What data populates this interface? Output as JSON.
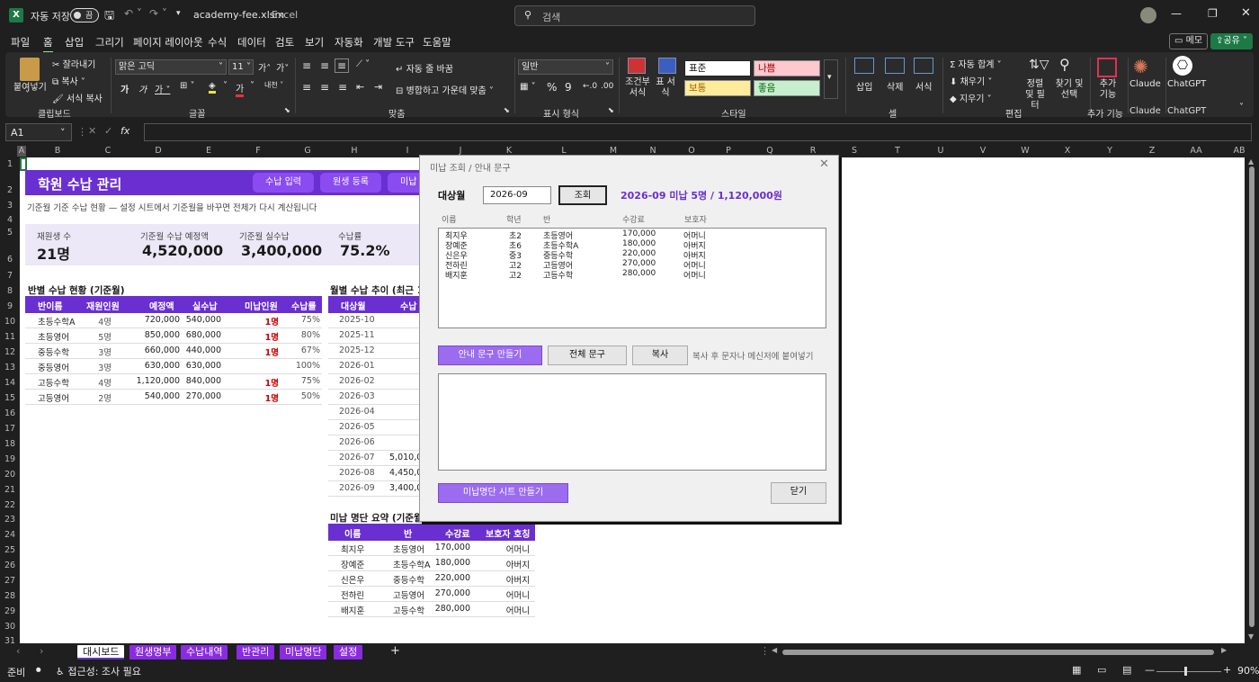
{
  "titlebar": {
    "autosave_label": "자동 저장",
    "toggle_state": "끔",
    "filename": "academy-fee.xlsm",
    "app": "Excel",
    "search_placeholder": "검색"
  },
  "menu": {
    "items": [
      "파일",
      "홈",
      "삽입",
      "그리기",
      "페이지 레이아웃",
      "수식",
      "데이터",
      "검토",
      "보기",
      "자동화",
      "개발 도구",
      "도움말"
    ],
    "active": "홈",
    "memo": "메모",
    "share": "공유"
  },
  "ribbon": {
    "clipboard": {
      "paste": "붙여넣기",
      "cut": "잘라내기",
      "copy": "복사",
      "format_painter": "서식 복사",
      "label": "클립보드"
    },
    "font": {
      "name": "맑은 고딕",
      "size": "11",
      "label": "글꼴"
    },
    "align": {
      "wrap": "자동 줄 바꿈",
      "merge": "병합하고 가운데 맞춤",
      "label": "맞춤"
    },
    "number": {
      "format": "일반",
      "label": "표시 형식"
    },
    "styles": {
      "cond": "조건부 서식",
      "table": "표 서식",
      "s1": "표준",
      "s2": "나쁨",
      "s3": "보통",
      "s4": "좋음",
      "label": "스타일"
    },
    "cells": {
      "insert": "삽입",
      "delete": "삭제",
      "format": "서식",
      "label": "셀"
    },
    "edit": {
      "autosum": "자동 합계",
      "fill": "채우기",
      "clear": "지우기",
      "sort": "정렬 및 필터",
      "find": "찾기 및 선택",
      "label": "편집"
    },
    "addins": {
      "label": "추가 기능",
      "btn": "추가 기능"
    },
    "claude": {
      "label": "Claude",
      "btn": "Claude"
    },
    "chatgpt": {
      "label": "ChatGPT",
      "btn": "ChatGPT"
    }
  },
  "formula": {
    "cell": "A1",
    "fx": "fx"
  },
  "columns": [
    "A",
    "B",
    "C",
    "D",
    "E",
    "F",
    "G",
    "H",
    "I",
    "J",
    "K",
    "L",
    "M",
    "N",
    "O",
    "P",
    "Q",
    "R",
    "S",
    "T",
    "U",
    "V",
    "W",
    "X",
    "Y",
    "Z",
    "AA",
    "AB"
  ],
  "rows": [
    "1",
    "2",
    "3",
    "4",
    "5",
    "6",
    "7",
    "8",
    "9",
    "10",
    "11",
    "12",
    "13",
    "14",
    "15",
    "16",
    "17",
    "18",
    "19",
    "20",
    "21",
    "22",
    "23",
    "24",
    "25",
    "26",
    "27",
    "28",
    "29",
    "30",
    "31"
  ],
  "sheet": {
    "title": "학원 수납 관리",
    "buttons": [
      "수납 입력",
      "원생 등록",
      "미납"
    ],
    "subtitle": "기준월 기준 수납 현황 — 설정 시트에서 기준월을 바꾸면 전체가 다시 계산됩니다",
    "kpis": [
      {
        "label": "재원생 수",
        "value": "21명"
      },
      {
        "label": "기준월 수납 예정액",
        "value": "4,520,000"
      },
      {
        "label": "기준월 실수납",
        "value": "3,400,000"
      },
      {
        "label": "수납률",
        "value": "75.2%"
      }
    ],
    "class_table": {
      "title": "반별 수납 현황 (기준월)",
      "headers": [
        "반이름",
        "재원인원",
        "예정액",
        "실수납",
        "미납인원",
        "수납률"
      ],
      "rows": [
        [
          "초등수학A",
          "4명",
          "720,000",
          "540,000",
          "1명",
          "75%"
        ],
        [
          "초등영어",
          "5명",
          "850,000",
          "680,000",
          "1명",
          "80%"
        ],
        [
          "중등수학",
          "3명",
          "660,000",
          "440,000",
          "1명",
          "67%"
        ],
        [
          "중등영어",
          "3명",
          "630,000",
          "630,000",
          "",
          "100%"
        ],
        [
          "고등수학",
          "4명",
          "1,120,000",
          "840,000",
          "1명",
          "75%"
        ],
        [
          "고등영어",
          "2명",
          "540,000",
          "270,000",
          "1명",
          "50%"
        ]
      ]
    },
    "monthly": {
      "title": "월별 수납 추이 (최근 1",
      "headers": [
        "대상월",
        "수납"
      ],
      "rows": [
        [
          "2025-10",
          ""
        ],
        [
          "2025-11",
          ""
        ],
        [
          "2025-12",
          ""
        ],
        [
          "2026-01",
          ""
        ],
        [
          "2026-02",
          ""
        ],
        [
          "2026-03",
          ""
        ],
        [
          "2026-04",
          ""
        ],
        [
          "2026-05",
          ""
        ],
        [
          "2026-06",
          ""
        ],
        [
          "2026-07",
          "5,010,0"
        ],
        [
          "2026-08",
          "4,450,0"
        ],
        [
          "2026-09",
          "3,400,0"
        ]
      ]
    },
    "unpaid": {
      "title": "미납 명단 요약 (기준월",
      "headers": [
        "이름",
        "반",
        "수강료",
        "보호자 호칭"
      ],
      "rows": [
        [
          "최지우",
          "초등영어",
          "170,000",
          "어머니"
        ],
        [
          "장예준",
          "초등수학A",
          "180,000",
          "아버지"
        ],
        [
          "신은우",
          "중등수학",
          "220,000",
          "아버지"
        ],
        [
          "전하린",
          "고등영어",
          "270,000",
          "어머니"
        ],
        [
          "배지훈",
          "고등수학",
          "280,000",
          "어머니"
        ]
      ]
    }
  },
  "dialog": {
    "title": "미납 조회 / 안내 문구",
    "month_label": "대상월",
    "month_value": "2026-09",
    "search_btn": "조회",
    "summary": "2026-09 미납 5명 / 1,120,000원",
    "list_headers": [
      "이름",
      "학년",
      "반",
      "수강료",
      "보호자"
    ],
    "list_rows": [
      [
        "최지우",
        "초2",
        "초등영어",
        "170,000",
        "어머니"
      ],
      [
        "장예준",
        "초6",
        "초등수학A",
        "180,000",
        "아버지"
      ],
      [
        "신은우",
        "중3",
        "중등수학",
        "220,000",
        "아버지"
      ],
      [
        "전하린",
        "고2",
        "고등영어",
        "270,000",
        "어머니"
      ],
      [
        "배지훈",
        "고2",
        "고등수학",
        "280,000",
        "어머니"
      ]
    ],
    "make_btn": "안내 문구 만들기",
    "all_btn": "전체 문구",
    "copy_btn": "복사",
    "hint": "복사 후 문자나 메신저에 붙여넣기",
    "sheet_btn": "미납명단 시트 만들기",
    "close_btn": "닫기"
  },
  "tabs": [
    "대시보드",
    "원생명부",
    "수납내역",
    "반관리",
    "미납명단",
    "설정"
  ],
  "active_tab": "대시보드",
  "status": {
    "ready": "준비",
    "accessibility": "접근성: 조사 필요",
    "zoom": "90%"
  }
}
